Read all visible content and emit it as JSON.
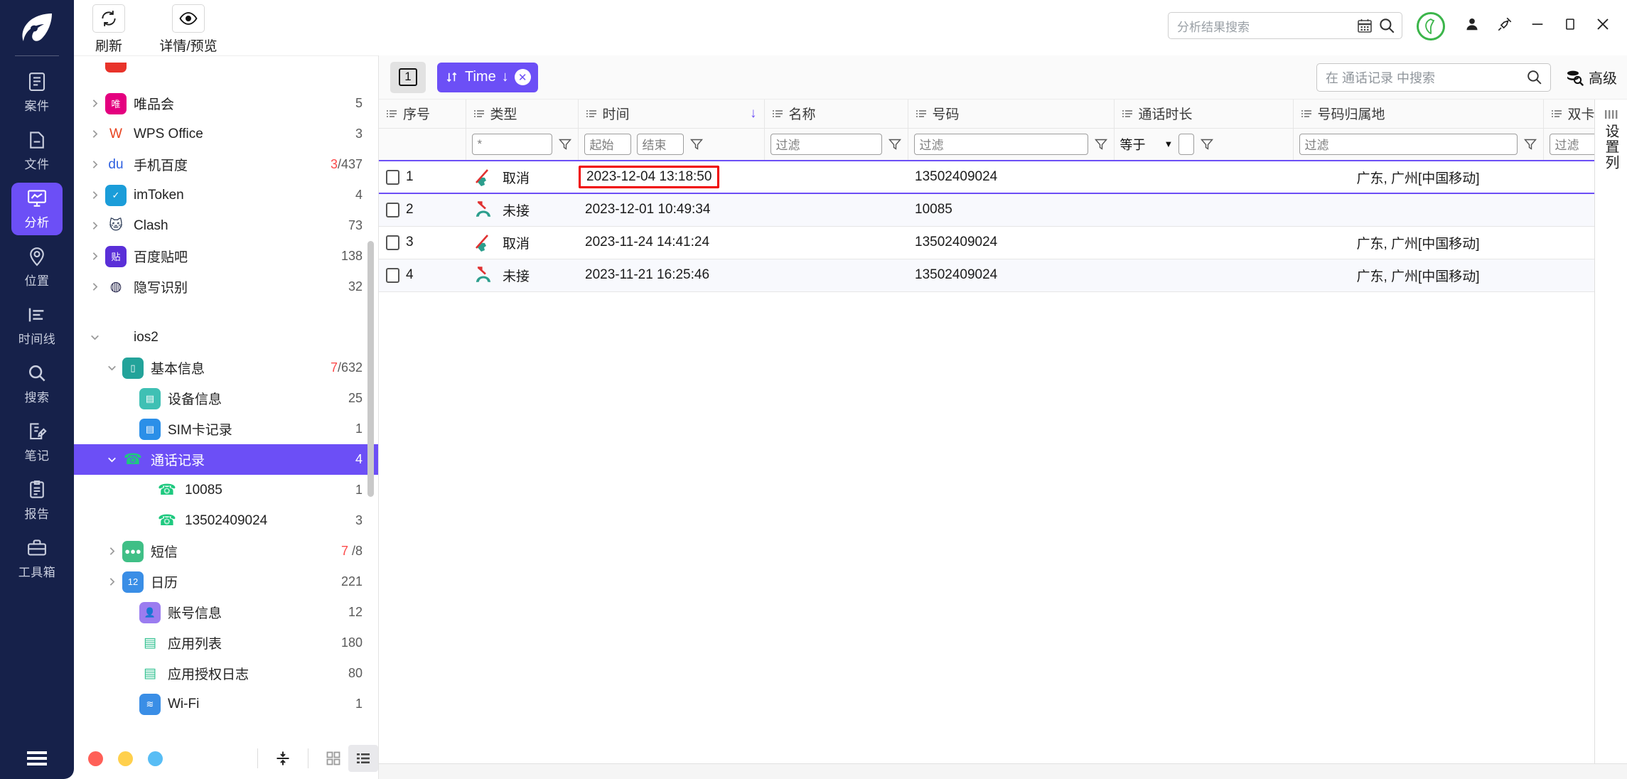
{
  "rail": {
    "logo_icon": "app-logo-icon",
    "items": [
      {
        "label": "案件",
        "icon": "case-icon",
        "active": false
      },
      {
        "label": "文件",
        "icon": "file-icon",
        "active": false
      },
      {
        "label": "分析",
        "icon": "analysis-icon",
        "active": true
      },
      {
        "label": "位置",
        "icon": "location-icon",
        "active": false
      },
      {
        "label": "时间线",
        "icon": "timeline-icon",
        "active": false
      },
      {
        "label": "搜索",
        "icon": "search-icon",
        "active": false
      },
      {
        "label": "笔记",
        "icon": "note-icon",
        "active": false
      },
      {
        "label": "报告",
        "icon": "report-icon",
        "active": false
      },
      {
        "label": "工具箱",
        "icon": "toolbox-icon",
        "active": false
      }
    ],
    "menu_icon": "hamburger-menu-icon"
  },
  "toolbar": {
    "refresh_label": "刷新",
    "refresh_icon": "refresh-icon",
    "preview_label": "详情/预览",
    "preview_icon": "eye-icon"
  },
  "global_search": {
    "placeholder": "分析结果搜索",
    "calendar_icon": "calendar-icon",
    "search_icon": "search-icon"
  },
  "window": {
    "badge_icon": "leaf-badge-icon",
    "user_icon": "user-icon",
    "pin_icon": "pin-icon",
    "minimize_icon": "minimize-icon",
    "maximize_icon": "maximize-icon",
    "close_icon": "close-icon"
  },
  "tree": {
    "items": [
      {
        "label": "",
        "count": "",
        "icon": "clipped-app-icon",
        "indent": 1,
        "arrow": "",
        "icon_bg": "#e8332a",
        "glyph": "",
        "clipped": true
      },
      {
        "label": "唯品会",
        "count": "5",
        "icon": "vipshop-icon",
        "indent": 1,
        "arrow": "right",
        "icon_bg": "#e4007f",
        "glyph": "唯"
      },
      {
        "label": "WPS Office",
        "count": "3",
        "icon": "wps-icon",
        "indent": 1,
        "arrow": "right",
        "icon_bg": "#ffffff",
        "glyph": "W",
        "glyph_color": "#e8431f"
      },
      {
        "label": "手机百度",
        "count": "3/437",
        "count_red": "3",
        "count_rest": "/437",
        "icon": "baidu-icon",
        "indent": 1,
        "arrow": "right",
        "icon_bg": "#ffffff",
        "glyph": "du",
        "glyph_color": "#2d5fe0"
      },
      {
        "label": "imToken",
        "count": "4",
        "icon": "imtoken-icon",
        "indent": 1,
        "arrow": "right",
        "icon_bg": "#1b9dd9",
        "glyph": "✓"
      },
      {
        "label": "Clash",
        "count": "73",
        "icon": "clash-icon",
        "indent": 1,
        "arrow": "right",
        "icon_bg": "#ffffff",
        "glyph": "🐱",
        "glyph_color": "#2b3a55"
      },
      {
        "label": "百度贴吧",
        "count": "138",
        "icon": "tieba-icon",
        "indent": 1,
        "arrow": "right",
        "icon_bg": "#5a2fd8",
        "glyph": "贴"
      },
      {
        "label": "隐写识别",
        "count": "32",
        "icon": "steganography-icon",
        "indent": 1,
        "arrow": "right",
        "icon_bg": "#ffffff",
        "glyph": "◍",
        "glyph_color": "#1d1d44"
      },
      {
        "label": "",
        "count": "",
        "icon": "",
        "indent": 0,
        "arrow": "",
        "spacer": true
      },
      {
        "label": "ios2",
        "count": "",
        "icon": "apple-icon",
        "indent": 1,
        "arrow": "down",
        "icon_bg": "#ffffff",
        "glyph": "",
        "glyph_color": "#b9c7e8"
      },
      {
        "label": "基本信息",
        "count": "7/632",
        "count_red": "7",
        "count_rest": "/632",
        "icon": "basic-info-icon",
        "indent": 2,
        "arrow": "down",
        "icon_bg": "#23a39a",
        "glyph": "▯"
      },
      {
        "label": "设备信息",
        "count": "25",
        "icon": "device-info-icon",
        "indent": 3,
        "arrow": "",
        "icon_bg": "#3fc0b4",
        "glyph": "▤"
      },
      {
        "label": "SIM卡记录",
        "count": "1",
        "icon": "sim-card-icon",
        "indent": 3,
        "arrow": "",
        "icon_bg": "#2b8fe8",
        "glyph": "▤"
      },
      {
        "label": "通话记录",
        "count": "4",
        "icon": "call-log-icon",
        "indent": 2,
        "arrow": "down",
        "icon_bg": "transparent",
        "glyph": "📞",
        "selected": true
      },
      {
        "label": "10085",
        "count": "1",
        "icon": "phone-icon",
        "indent": 4,
        "arrow": "",
        "icon_bg": "transparent",
        "glyph": "📞"
      },
      {
        "label": "13502409024",
        "count": "3",
        "icon": "phone-icon",
        "indent": 4,
        "arrow": "",
        "icon_bg": "transparent",
        "glyph": "📞"
      },
      {
        "label": "短信",
        "count": "7 /8",
        "count_red": "7",
        "count_rest": " /8",
        "icon": "sms-icon",
        "indent": 2,
        "arrow": "right",
        "icon_bg": "#3fbf86",
        "glyph": "●●●"
      },
      {
        "label": "日历",
        "count": "221",
        "icon": "calendar-icon",
        "indent": 2,
        "arrow": "right",
        "icon_bg": "#3a8ee6",
        "glyph": "12"
      },
      {
        "label": "账号信息",
        "count": "12",
        "icon": "account-info-icon",
        "indent": 3,
        "arrow": "",
        "icon_bg": "#9b7cf0",
        "glyph": "👤"
      },
      {
        "label": "应用列表",
        "count": "180",
        "icon": "app-list-icon",
        "indent": 3,
        "arrow": "",
        "icon_bg": "#ffffff",
        "glyph": "▤",
        "glyph_color": "#2fc08f"
      },
      {
        "label": "应用授权日志",
        "count": "80",
        "icon": "app-permission-log-icon",
        "indent": 3,
        "arrow": "",
        "icon_bg": "#ffffff",
        "glyph": "▤",
        "glyph_color": "#2fc08f"
      },
      {
        "label": "Wi-Fi",
        "count": "1",
        "icon": "wifi-icon",
        "indent": 3,
        "arrow": "",
        "icon_bg": "#3a8ee6",
        "glyph": "≋"
      }
    ],
    "footer": {
      "dots": [
        "#ff6058",
        "#ffd04d",
        "#58bdf5"
      ],
      "collapse_icon": "collapse-rows-icon",
      "grid_view_icon": "grid-view-icon",
      "list_view_icon": "list-view-icon"
    }
  },
  "filterbar": {
    "page_chip": "1",
    "sort_chip_label": "Time",
    "sort_chip_dir": "↓",
    "sort_chip_icon": "sort-icon",
    "sort_chip_close": "✕",
    "local_search_placeholder": "在 通话记录 中搜索",
    "local_search_icon": "search-icon",
    "advanced_label": "高级",
    "advanced_icon": "advanced-search-icon"
  },
  "table": {
    "columns": [
      {
        "key": "idx",
        "label": "序号",
        "menu_icon": "column-menu-icon"
      },
      {
        "key": "type",
        "label": "类型",
        "menu_icon": "column-menu-icon"
      },
      {
        "key": "time",
        "label": "时间",
        "menu_icon": "column-menu-icon",
        "sorted": "↓"
      },
      {
        "key": "name",
        "label": "名称",
        "menu_icon": "column-menu-icon"
      },
      {
        "key": "number",
        "label": "号码",
        "menu_icon": "column-menu-icon"
      },
      {
        "key": "duration",
        "label": "通话时长",
        "menu_icon": "column-menu-icon"
      },
      {
        "key": "region",
        "label": "号码归属地",
        "menu_icon": "column-menu-icon"
      },
      {
        "key": "simflag",
        "label": "双卡标识",
        "menu_icon": "column-menu-icon"
      }
    ],
    "filters": {
      "type_value": "*",
      "time_start_placeholder": "起始",
      "time_end_placeholder": "结束",
      "name_placeholder": "过滤",
      "number_placeholder": "过滤",
      "duration_operator": "等于",
      "duration_value": "",
      "region_placeholder": "过滤",
      "simflag_placeholder": "过滤",
      "funnel_icon": "filter-funnel-icon",
      "dropdown_icon": "chevron-down-icon"
    },
    "rows": [
      {
        "idx": "1",
        "type": "取消",
        "type_icon": "call-cancelled-icon",
        "time": "2023-12-04 13:18:50",
        "time_highlighted": true,
        "name": "",
        "number": "13502409024",
        "duration": "",
        "region": "广东, 广州[中国移动]",
        "simflag": "",
        "selected": true
      },
      {
        "idx": "2",
        "type": "未接",
        "type_icon": "call-missed-icon",
        "time": "2023-12-01 10:49:34",
        "time_highlighted": false,
        "name": "",
        "number": "10085",
        "duration": "",
        "region": "",
        "simflag": ""
      },
      {
        "idx": "3",
        "type": "取消",
        "type_icon": "call-cancelled-icon",
        "time": "2023-11-24 14:41:24",
        "time_highlighted": false,
        "name": "",
        "number": "13502409024",
        "duration": "",
        "region": "广东, 广州[中国移动]",
        "simflag": ""
      },
      {
        "idx": "4",
        "type": "未接",
        "type_icon": "call-missed-icon",
        "time": "2023-11-21 16:25:46",
        "time_highlighted": false,
        "name": "",
        "number": "13502409024",
        "duration": "",
        "region": "广东, 广州[中国移动]",
        "simflag": ""
      }
    ]
  },
  "settings_column": {
    "label": "设置列",
    "grip_icon": "grip-lines-icon"
  },
  "colors": {
    "accent": "#6c4ff6",
    "rail_bg": "#16214a",
    "highlight_box": "#f00000",
    "green": "#3bb54a"
  }
}
